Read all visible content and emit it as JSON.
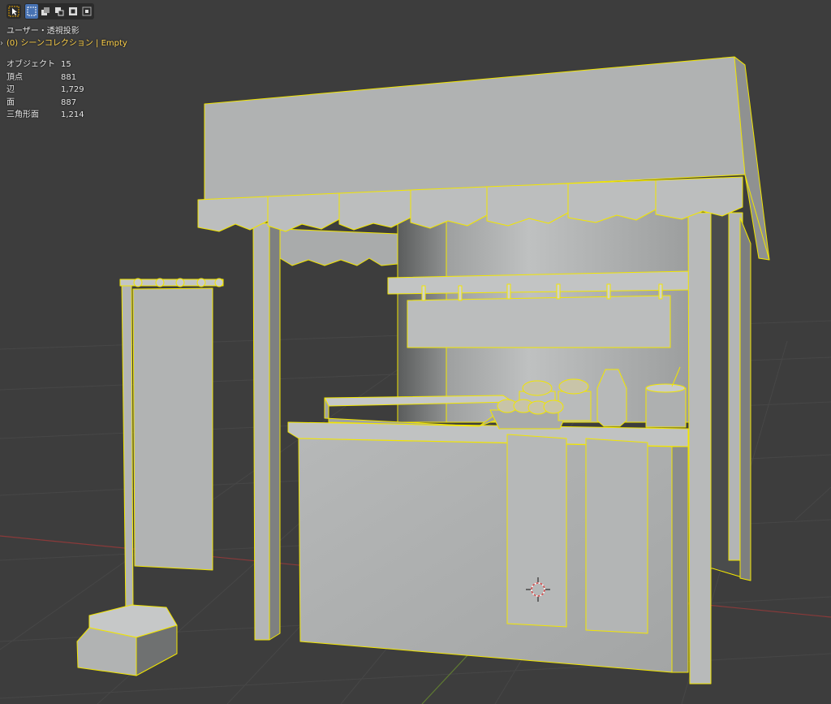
{
  "viewport": {
    "view_label": "ユーザー・透視投影",
    "collection_label": "(0) シーンコレクション | Empty"
  },
  "stats": [
    {
      "label": "オブジェクト",
      "value": "15"
    },
    {
      "label": "頂点",
      "value": "881"
    },
    {
      "label": "辺",
      "value": "1,729"
    },
    {
      "label": "面",
      "value": "887"
    },
    {
      "label": "三角形面",
      "value": "1,214"
    }
  ],
  "toolbar": {
    "tool_icon": "select-cursor-icon",
    "selection_mode_icons": [
      "select-new-icon",
      "select-extend-icon",
      "select-subtract-icon",
      "select-invert-icon",
      "select-intersect-icon"
    ]
  },
  "colors": {
    "background": "#3d3d3d",
    "grid_line": "#474747",
    "x_axis": "#8a3a3a",
    "y_axis": "#5f7a32",
    "selection_outline": "#ffee00",
    "collection_text": "#ffd24a",
    "active_mode": "#4772b3"
  }
}
